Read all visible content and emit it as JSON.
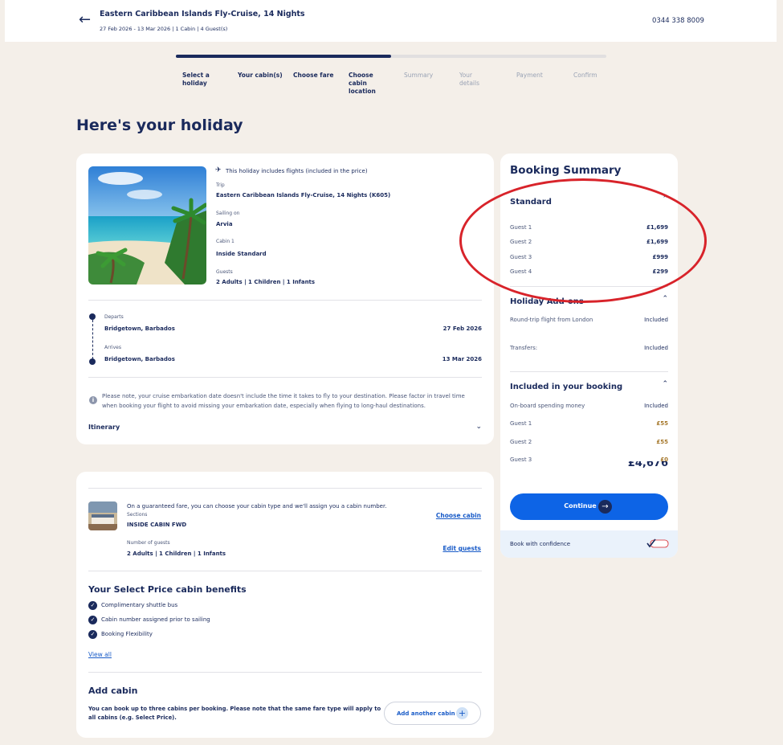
{
  "header": {
    "back_icon": "arrow-left-icon",
    "title": "Eastern Caribbean Islands Fly-Cruise, 14 Nights",
    "meta": "27 Feb 2026 - 13 Mar 2026  | 1 Cabin | 4 Guest(s)",
    "phone": "0344 338 8009"
  },
  "progress": {
    "completed_fraction": 0.5
  },
  "steps": [
    {
      "label": "Select a holiday",
      "state": "done"
    },
    {
      "label": "Your cabin(s)",
      "state": "done"
    },
    {
      "label": "Choose fare",
      "state": "done"
    },
    {
      "label": "Choose cabin location",
      "state": "done"
    },
    {
      "label": "Summary",
      "state": "upcoming"
    },
    {
      "label": "Your details",
      "state": "upcoming"
    },
    {
      "label": "Payment",
      "state": "upcoming"
    },
    {
      "label": "Confirm",
      "state": "upcoming"
    }
  ],
  "page_title": "Here's your holiday",
  "holiday": {
    "flights_note": "This holiday includes flights (included in the price)",
    "trip_label": "Trip",
    "trip_value": "Eastern Caribbean Islands Fly-Cruise, 14 Nights (K605)",
    "sailing_label": "Sailing on",
    "sailing_value": "Arvia",
    "cabin_label": "Cabin 1",
    "cabin_value": "Inside Standard",
    "guests_label": "Guests",
    "guests_value": "2 Adults | 1 Children | 1 Infants",
    "departs_label": "Departs",
    "departs_place": "Bridgetown, Barbados",
    "departs_date": "27 Feb 2026",
    "arrives_label": "Arrives",
    "arrives_place": "Bridgetown, Barbados",
    "arrives_date": "13 Mar 2026",
    "note": "Please note, your cruise embarkation date doesn't include the time it takes to fly to your destination. Please factor in travel time when booking your flight to avoid missing your embarkation date, especially when flying to long-haul destinations.",
    "itinerary_label": "Itinerary"
  },
  "cabin": {
    "guarantee_text": "On a guaranteed fare, you can choose your cabin type and we'll assign you a cabin number.",
    "sections_label": "Sections",
    "sections_value": "INSIDE CABIN FWD",
    "choose_cabin": "Choose cabin",
    "num_guests_label": "Number of guests",
    "num_guests_value": "2  Adults | 1 Children | 1 Infants",
    "edit_guests": "Edit guests",
    "benefits_title": "Your Select Price cabin benefits",
    "benefits": [
      "Complimentary shuttle bus",
      "Cabin number assigned prior to sailing",
      "Booking Flexibility"
    ],
    "view_all": "View all",
    "add_cabin_title": "Add cabin",
    "add_cabin_text": "You can book up to three cabins per booking. Please note that the same fare type will apply to all cabins (e.g. Select Price).",
    "add_cabin_button": "Add another cabin"
  },
  "summary": {
    "title": "Booking Summary",
    "standard_title": "Standard",
    "standard_rows": [
      {
        "label": "Guest 1",
        "value": "£1,699"
      },
      {
        "label": "Guest 2",
        "value": "£1,699"
      },
      {
        "label": "Guest 3",
        "value": "£999"
      },
      {
        "label": "Guest 4",
        "value": "£299"
      }
    ],
    "addons_title": "Holiday Add-ons",
    "addons_rows": [
      {
        "label": "Round-trip flight from London",
        "value": "Included"
      },
      {
        "label": "Transfers:",
        "value": "Included"
      }
    ],
    "included_title": "Included in your booking",
    "included_rows": [
      {
        "label": "On-board spending money",
        "value": "Included"
      },
      {
        "label": "Guest 1",
        "value": "£55"
      },
      {
        "label": "Guest 2",
        "value": "£55"
      },
      {
        "label": "Guest 3",
        "value": "£0"
      }
    ],
    "total_partial": "£4,676",
    "continue": "Continue",
    "confidence": "Book with confidence"
  },
  "colors": {
    "navy": "#1a2a5c",
    "accent_blue": "#0d64e6",
    "annotation_red": "#d8232a",
    "background": "#f4efe9"
  }
}
